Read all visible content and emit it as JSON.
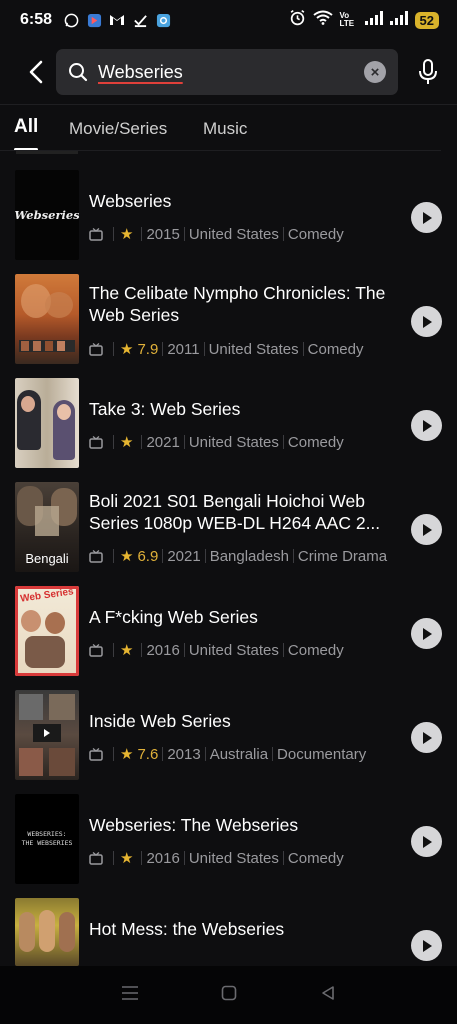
{
  "status": {
    "time": "6:58",
    "signal_label": "Vo LTE",
    "battery": "52"
  },
  "search": {
    "value": "Webseries",
    "placeholder": "Search"
  },
  "tabs": [
    {
      "label": "All",
      "active": true
    },
    {
      "label": "Movie/Series",
      "active": false
    },
    {
      "label": "Music",
      "active": false
    }
  ],
  "results": [
    {
      "title": "Webseries",
      "rating": "",
      "year": "2015",
      "country": "United States",
      "genre": "Comedy",
      "thumb_text": "Webseries"
    },
    {
      "title": "The Celibate Nympho Chronicles: The Web Series",
      "rating": "7.9",
      "year": "2011",
      "country": "United States",
      "genre": "Comedy",
      "thumb_text": ""
    },
    {
      "title": "Take 3: Web Series",
      "rating": "",
      "year": "2021",
      "country": "United States",
      "genre": "Comedy",
      "thumb_text": ""
    },
    {
      "title": "Boli 2021 S01 Bengali Hoichoi Web Series 1080p WEB-DL H264 AAC 2...",
      "rating": "6.9",
      "year": "2021",
      "country": "Bangladesh",
      "genre": "Crime  Drama",
      "thumb_text": "Bengali"
    },
    {
      "title": "A F*cking Web Series",
      "rating": "",
      "year": "2016",
      "country": "United States",
      "genre": "Comedy",
      "thumb_text": "Web Series"
    },
    {
      "title": "Inside Web Series",
      "rating": "7.6",
      "year": "2013",
      "country": "Australia",
      "genre": "Documentary",
      "thumb_text": ""
    },
    {
      "title": "Webseries: The Webseries",
      "rating": "",
      "year": "2016",
      "country": "United States",
      "genre": "Comedy",
      "thumb_text": "WEBSERIES:\nTHE WEBSERIES"
    },
    {
      "title": "Hot Mess: the Webseries",
      "rating": "",
      "year": "",
      "country": "",
      "genre": "",
      "thumb_text": ""
    }
  ],
  "colors": {
    "background": "#0e0e10",
    "rating": "#e0b13a",
    "meta": "#9a9a9e",
    "underline": "#e0403a"
  }
}
